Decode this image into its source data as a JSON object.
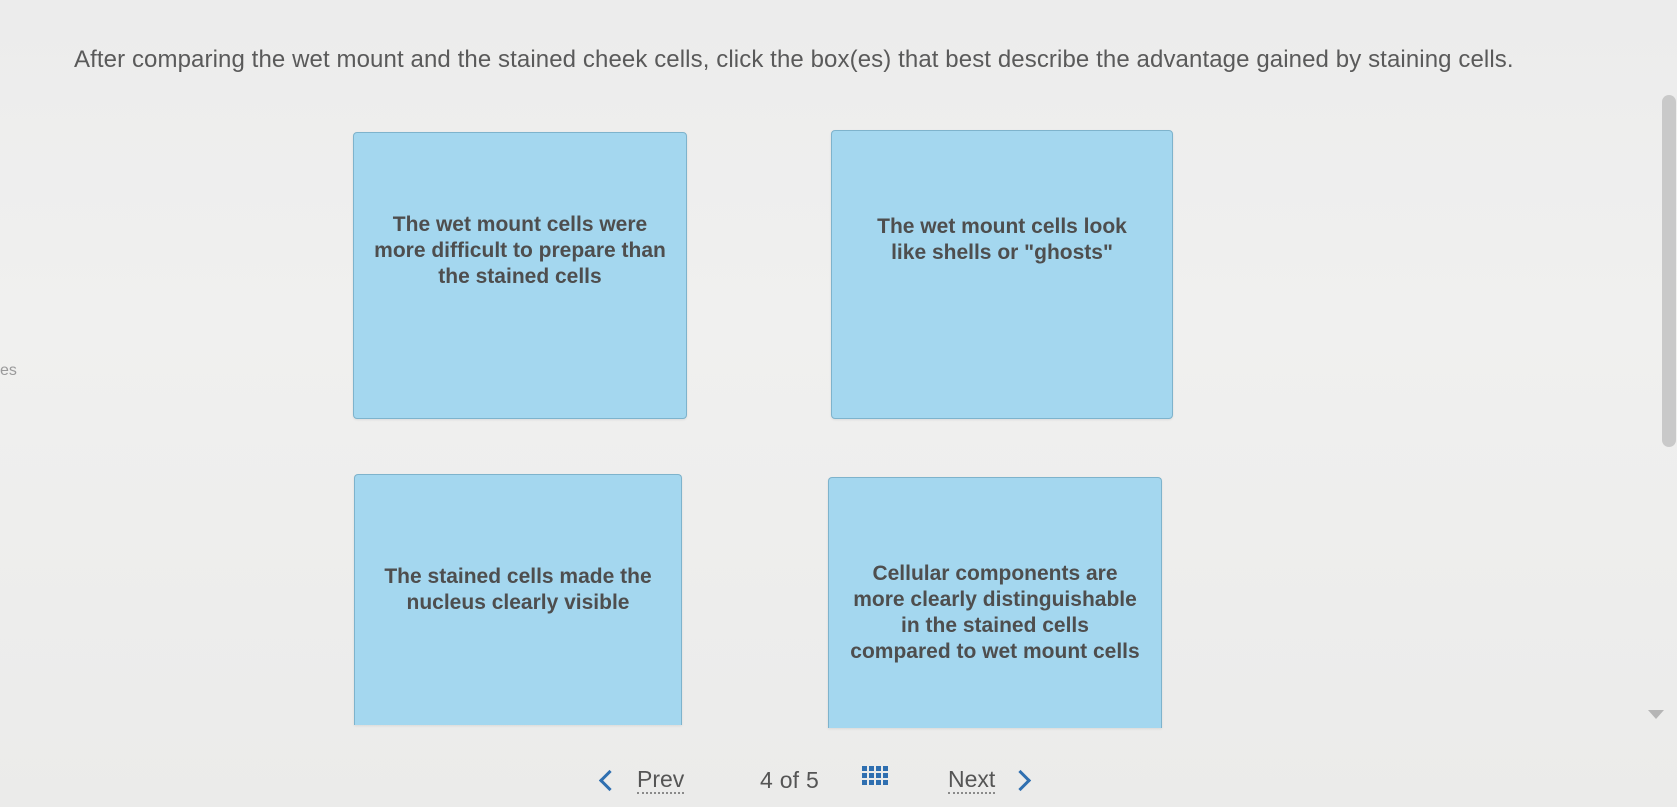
{
  "question": {
    "text": "After comparing the wet mount and the stained cheek cells, click the box(es) that best describe the advantage gained by staining cells."
  },
  "side_fragment": "es",
  "options": [
    {
      "label": "The wet mount cells were more difficult to prepare than the stained cells"
    },
    {
      "label": "The wet mount cells look like shells or \"ghosts\""
    },
    {
      "label": "The stained cells made the nucleus clearly visible"
    },
    {
      "label": "Cellular components are more clearly distinguishable in the stained cells compared to wet mount cells"
    }
  ],
  "nav": {
    "prev_label": "Prev",
    "current_page": "4",
    "of_label": "of",
    "total_pages": "5",
    "next_label": "Next",
    "grid_icon": "grid-menu-icon"
  },
  "colors": {
    "option_fill": "#a4d7ef",
    "option_border": "#7eb3cc",
    "accent": "#2f6fb0"
  }
}
